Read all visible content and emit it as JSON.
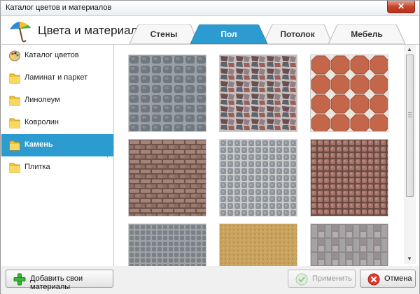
{
  "window": {
    "title": "Каталог цветов и материалов",
    "close_label": "✕"
  },
  "header": {
    "heading": "Цвета и материалы"
  },
  "tabs": [
    {
      "label": "Стены",
      "active": false
    },
    {
      "label": "Пол",
      "active": true
    },
    {
      "label": "Потолок",
      "active": false
    },
    {
      "label": "Мебель",
      "active": false
    }
  ],
  "sidebar": {
    "items": [
      {
        "label": "Каталог цветов",
        "icon": "palette-icon",
        "active": false
      },
      {
        "label": "Ламинат и паркет",
        "icon": "folder-icon",
        "active": false
      },
      {
        "label": "Линолеум",
        "icon": "folder-icon",
        "active": false
      },
      {
        "label": "Ковролин",
        "icon": "folder-icon",
        "active": false
      },
      {
        "label": "Камень",
        "icon": "folder-icon",
        "active": true
      },
      {
        "label": "Плитка",
        "icon": "folder-icon",
        "active": false
      }
    ]
  },
  "materials": {
    "tiles": [
      {
        "name": "grey-cobblestone"
      },
      {
        "name": "mixed-flagstone"
      },
      {
        "name": "terracotta-octagon-tile"
      },
      {
        "name": "brown-paving-blocks"
      },
      {
        "name": "grey-fan-cobble"
      },
      {
        "name": "reddish-fan-cobble"
      },
      {
        "name": "grey-arc-cobble"
      },
      {
        "name": "sand-stone"
      },
      {
        "name": "grey-pattern-pavers"
      }
    ]
  },
  "footer": {
    "add_label": "Добавить свои материалы",
    "apply_label": "Применить",
    "cancel_label": "Отмена"
  },
  "colors": {
    "accent": "#2b9bd0",
    "window_bg": "#f0f0f0"
  }
}
